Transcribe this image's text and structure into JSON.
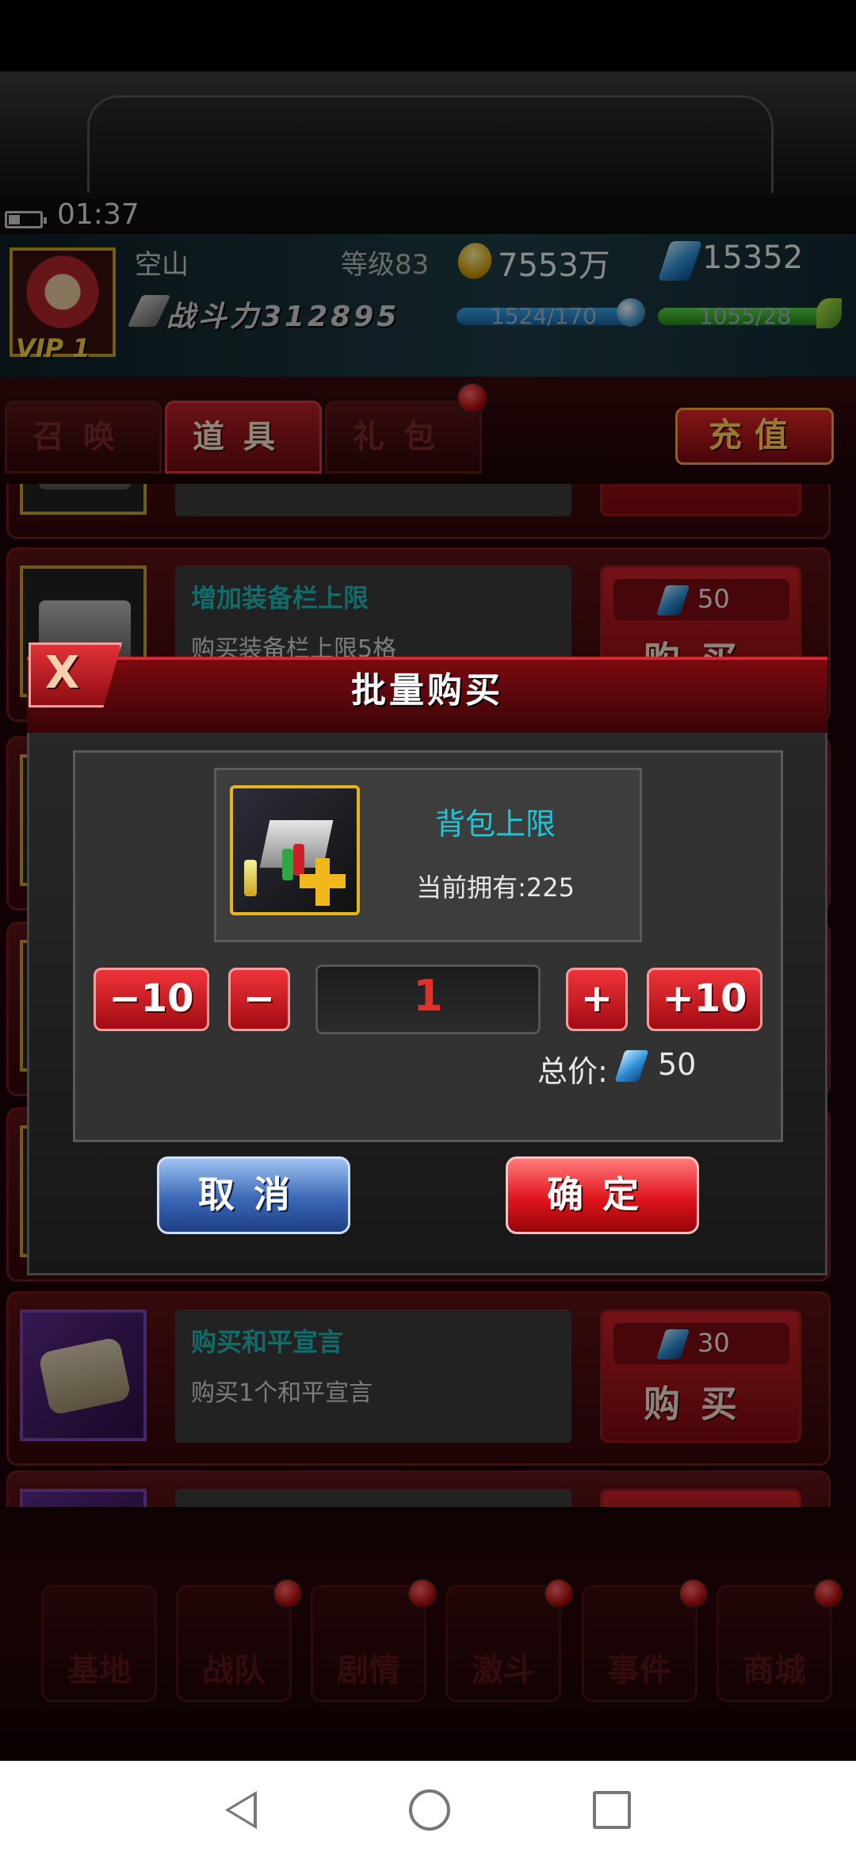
{
  "status": {
    "time": "01:37"
  },
  "player": {
    "name": "空山",
    "level": "等级83",
    "gold": "7553万",
    "gems": "15352",
    "vip": "VIP 1",
    "power": "战斗力312895",
    "stamina": "1524/170",
    "energy": "1055/28"
  },
  "tabs": [
    {
      "label": "召唤"
    },
    {
      "label": "道具"
    },
    {
      "label": "礼包"
    }
  ],
  "recharge_label": "充值",
  "items": [
    {
      "title": "增加装备栏上限",
      "desc": "购买装备栏上限5格",
      "price": "50",
      "buy": "购买"
    },
    {
      "title": "购买和平宣言",
      "desc": "购买1个和平宣言",
      "price": "30",
      "buy": "购买"
    }
  ],
  "nav": [
    {
      "label": "基地"
    },
    {
      "label": "战队"
    },
    {
      "label": "剧情"
    },
    {
      "label": "激斗"
    },
    {
      "label": "事件"
    },
    {
      "label": "商城"
    }
  ],
  "dialog": {
    "close": "X",
    "title": "批量购买",
    "item_name": "背包上限",
    "owned": "当前拥有:225",
    "minus10": "−10",
    "minus": "−",
    "quantity": "1",
    "plus": "+",
    "plus10": "+10",
    "total_label": "总价:",
    "total_value": "50",
    "cancel": "取消",
    "confirm": "确定"
  }
}
